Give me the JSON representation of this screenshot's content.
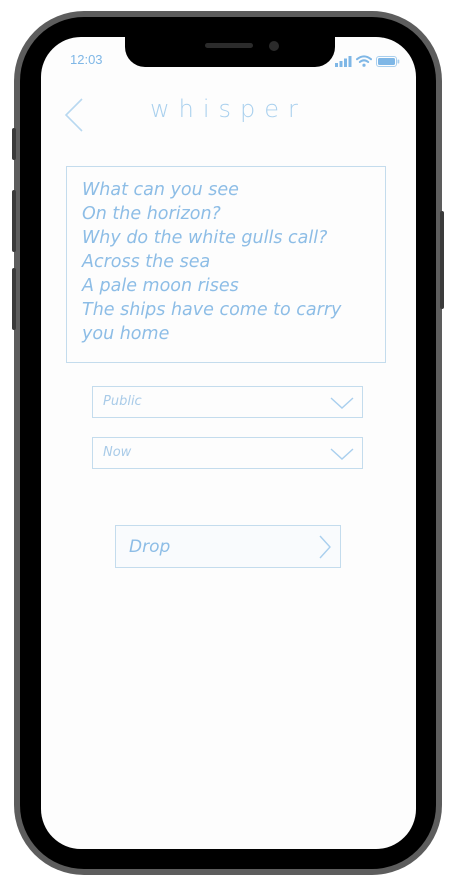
{
  "status_bar": {
    "time": "12:03"
  },
  "header": {
    "title": "whisper",
    "back_icon": "chevron-left-icon"
  },
  "poem": {
    "lines": [
      "What can you see",
      "On the horizon?",
      "Why do the white gulls call?",
      "Across the sea",
      "A pale moon rises",
      "The ships have come to carry",
      "you home"
    ]
  },
  "visibility_select": {
    "value": "Public",
    "icon": "chevron-down-icon"
  },
  "schedule_select": {
    "value": "Now",
    "icon": "chevron-down-icon"
  },
  "drop_button": {
    "label": "Drop",
    "icon": "chevron-right-icon"
  },
  "colors": {
    "accent": "#8dbde6",
    "border": "#c4dced",
    "battery": "#7fb7e6"
  }
}
